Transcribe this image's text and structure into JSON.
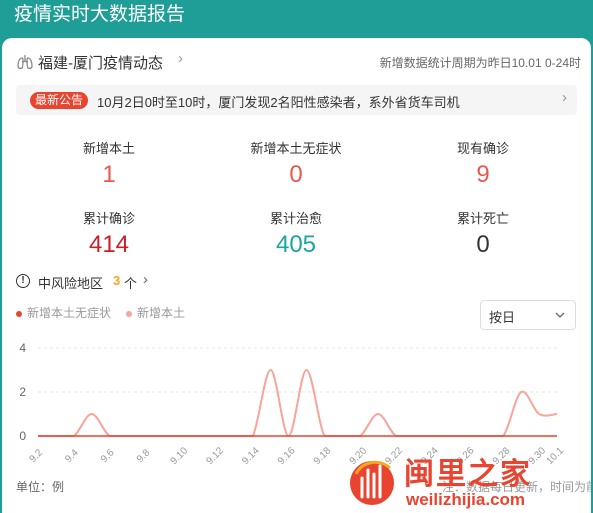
{
  "header": {
    "title": "疫情实时大数据报告"
  },
  "city": {
    "title": "福建-厦门疫情动态",
    "period": "新增数据统计周期为昨日10.01 0-24时"
  },
  "notice": {
    "badge": "最新公告",
    "text": "10月2日0时至10时，厦门发现2名阳性感染者，系外省货车司机"
  },
  "stats": [
    {
      "label": "新增本土",
      "value": "1",
      "color": "#e8584f"
    },
    {
      "label": "新增本土无症状",
      "value": "0",
      "color": "#e8584f"
    },
    {
      "label": "现有确诊",
      "value": "9",
      "color": "#e8584f"
    },
    {
      "label": "累计确诊",
      "value": "414",
      "color": "#c8202a"
    },
    {
      "label": "累计治愈",
      "value": "405",
      "color": "#1aa6a0"
    },
    {
      "label": "累计死亡",
      "value": "0",
      "color": "#333333"
    }
  ],
  "risk": {
    "label": "中风险地区",
    "count": "3",
    "unit": "个"
  },
  "legend": [
    {
      "name": "新增本土无症状",
      "color": "#e8442f"
    },
    {
      "name": "新增本土",
      "color": "#f7a59b"
    }
  ],
  "select": {
    "value": "按日"
  },
  "chart_data": {
    "type": "line",
    "x": [
      "9.2",
      "9.3",
      "9.4",
      "9.5",
      "9.6",
      "9.7",
      "9.8",
      "9.9",
      "9.10",
      "9.11",
      "9.12",
      "9.13",
      "9.14",
      "9.15",
      "9.16",
      "9.17",
      "9.18",
      "9.19",
      "9.20",
      "9.21",
      "9.22",
      "9.23",
      "9.24",
      "9.25",
      "9.26",
      "9.27",
      "9.28",
      "9.29",
      "9.30",
      "10.1"
    ],
    "xtick_labels": [
      "9.2",
      "9.4",
      "9.6",
      "9.8",
      "9.10",
      "9.12",
      "9.14",
      "9.16",
      "9.18",
      "9.20",
      "9.22",
      "9.24",
      "9.26",
      "9.28",
      "9.30",
      "10.1"
    ],
    "yticks": [
      "0",
      "2",
      "4"
    ],
    "ylim": [
      0,
      4
    ],
    "series": [
      {
        "name": "新增本土无症状",
        "color": "#e8442f",
        "values": [
          0,
          0,
          0,
          0,
          0,
          0,
          0,
          0,
          0,
          0,
          0,
          0,
          0,
          0,
          0,
          0,
          0,
          0,
          0,
          0,
          0,
          0,
          0,
          0,
          0,
          0,
          0,
          0,
          0,
          0
        ]
      },
      {
        "name": "新增本土",
        "color": "#f7a59b",
        "values": [
          0,
          0,
          0,
          1,
          0,
          0,
          0,
          0,
          0,
          0,
          0,
          0,
          0,
          3,
          0,
          3,
          0,
          0,
          0,
          1,
          0,
          0,
          0,
          0,
          0,
          0,
          0,
          2,
          1,
          1
        ]
      }
    ]
  },
  "footer": {
    "unit": "单位：例",
    "update_note": "注：数据每日更新，时间为前一日"
  },
  "watermark": {
    "name": "闽里之家",
    "url": "weilizhijia.com"
  }
}
